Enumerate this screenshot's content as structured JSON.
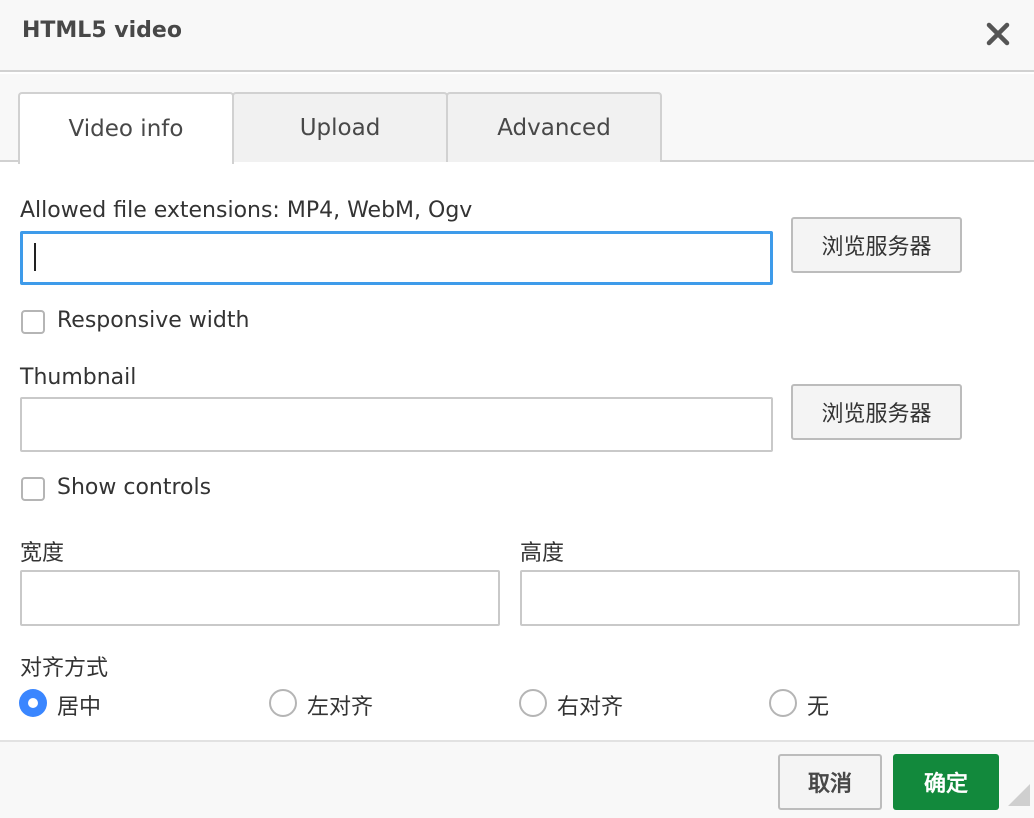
{
  "dialog": {
    "title": "HTML5 video",
    "close_icon": "close-icon"
  },
  "tabs": [
    {
      "label": "Video info",
      "active": true
    },
    {
      "label": "Upload",
      "active": false
    },
    {
      "label": "Advanced",
      "active": false
    }
  ],
  "form": {
    "url_label": "Allowed file extensions: MP4, WebM, Ogv",
    "url_value": "",
    "browse_label": "浏览服务器",
    "responsive_label": "Responsive width",
    "responsive_checked": false,
    "thumbnail_label": "Thumbnail",
    "thumbnail_value": "",
    "thumbnail_browse_label": "浏览服务器",
    "controls_label": "Show controls",
    "controls_checked": false,
    "width_label": "宽度",
    "width_value": "",
    "height_label": "高度",
    "height_value": "",
    "align_label": "对齐方式",
    "align_options": [
      {
        "label": "居中",
        "checked": true
      },
      {
        "label": "左对齐",
        "checked": false
      },
      {
        "label": "右对齐",
        "checked": false
      },
      {
        "label": "无",
        "checked": false
      }
    ]
  },
  "footer": {
    "cancel_label": "取消",
    "ok_label": "确定"
  },
  "colors": {
    "accent": "#3e9bea",
    "ok_button": "#12893c",
    "radio_checked": "#3a86ff"
  }
}
